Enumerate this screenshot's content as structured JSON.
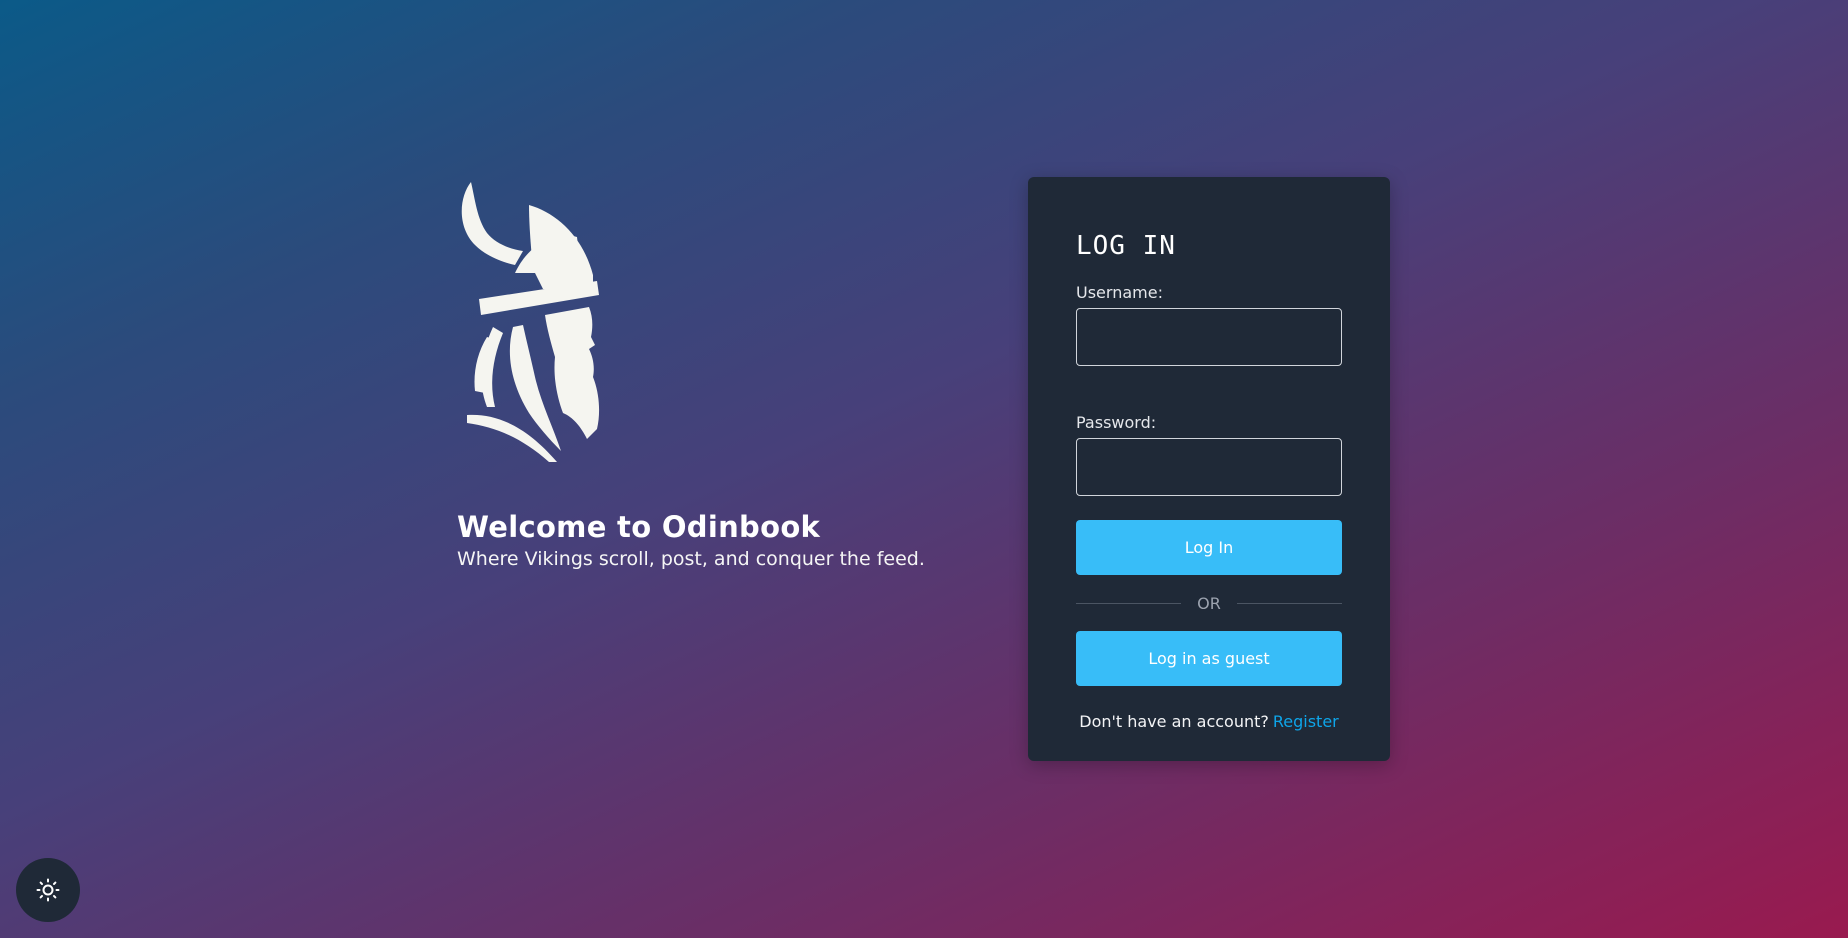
{
  "hero": {
    "title": "Welcome to Odinbook",
    "subtitle": "Where Vikings scroll, post, and conquer the feed.",
    "logo_icon": "viking-head-logo"
  },
  "login": {
    "title": "LOG IN",
    "username_label": "Username:",
    "username_value": "",
    "password_label": "Password:",
    "password_value": "",
    "login_button": "Log In",
    "or_text": "OR",
    "guest_button": "Log in as guest",
    "no_account_text": "Don't have an account?",
    "register_link": "Register"
  },
  "theme_toggle": {
    "icon": "sun-icon"
  },
  "colors": {
    "card_bg": "#1f2937",
    "accent": "#38bdf8",
    "link": "#0ea5e9"
  }
}
